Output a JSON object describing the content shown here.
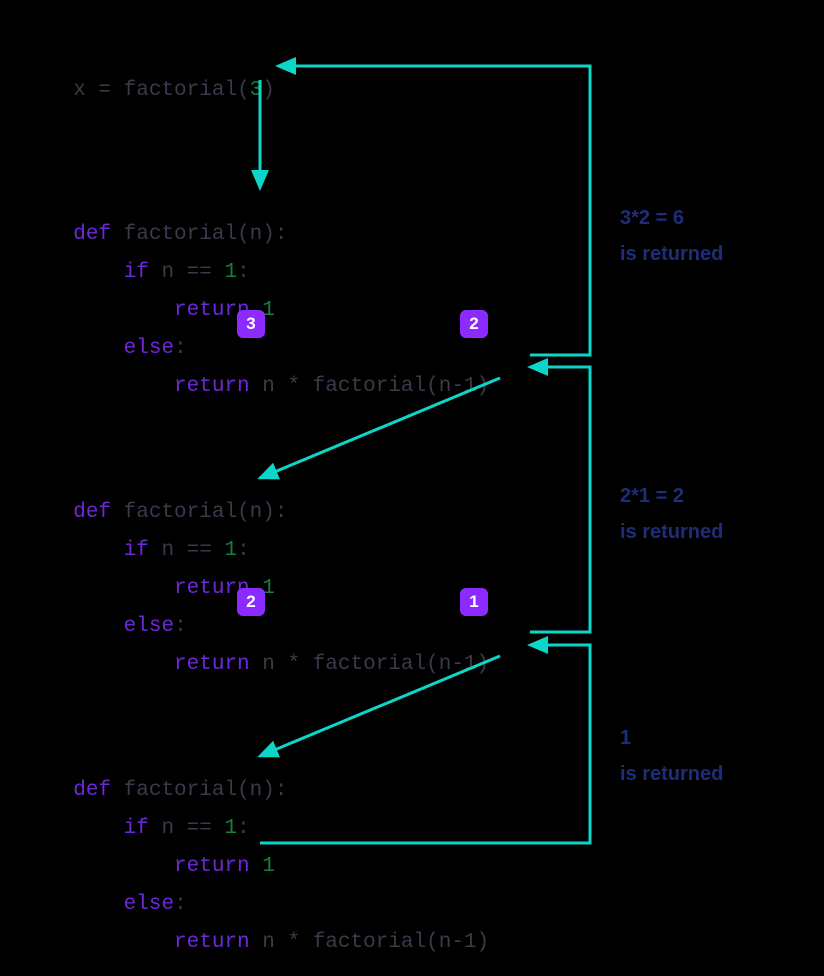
{
  "call_line": "x = factorial(3)",
  "blocks": [
    {
      "def_prefix": "def ",
      "fn_name": "factorial",
      "open_paren": "(",
      "param": "n",
      "close_def": "):",
      "if_kw": "if ",
      "if_cond": "n == ",
      "if_num": "1",
      "if_colon": ":",
      "ret1_kw": "return ",
      "ret1_num": "1",
      "else_kw": "else",
      "else_colon": ":",
      "ret2_kw": "return ",
      "ret2_expr1": "n * ",
      "ret2_fn": "factorial",
      "ret2_open": "(",
      "ret2_arg": "n-1",
      "ret2_close": ")"
    },
    {
      "def_prefix": "def ",
      "fn_name": "factorial",
      "open_paren": "(",
      "param": "n",
      "close_def": "):",
      "if_kw": "if ",
      "if_cond": "n == ",
      "if_num": "1",
      "if_colon": ":",
      "ret1_kw": "return ",
      "ret1_num": "1",
      "else_kw": "else",
      "else_colon": ":",
      "ret2_kw": "return ",
      "ret2_expr1": "n * ",
      "ret2_fn": "factorial",
      "ret2_open": "(",
      "ret2_arg": "n-1",
      "ret2_close": ")"
    },
    {
      "def_prefix": "def ",
      "fn_name": "factorial",
      "open_paren": "(",
      "param": "n",
      "close_def": "):",
      "if_kw": "if ",
      "if_cond": "n == ",
      "if_num": "1",
      "if_colon": ":",
      "ret1_kw": "return ",
      "ret1_num": "1",
      "else_kw": "else",
      "else_colon": ":",
      "ret2_kw": "return ",
      "ret2_expr1": "n * ",
      "ret2_fn": "factorial",
      "ret2_open": "(",
      "ret2_arg": "n-1",
      "ret2_close": ")"
    }
  ],
  "badges": {
    "b1_n": "3",
    "b1_arg": "2",
    "b2_n": "2",
    "b2_arg": "1"
  },
  "annotations": {
    "a1_l1": "3*2 = 6",
    "a1_l2": "is returned",
    "a2_l1": "2*1 = 2",
    "a2_l2": "is returned",
    "a3_l1": "1",
    "a3_l2": "is returned"
  },
  "colors": {
    "arrow": "#0cd6c7",
    "badge_bg": "#8b2bff",
    "annot": "#1e2d7a"
  }
}
